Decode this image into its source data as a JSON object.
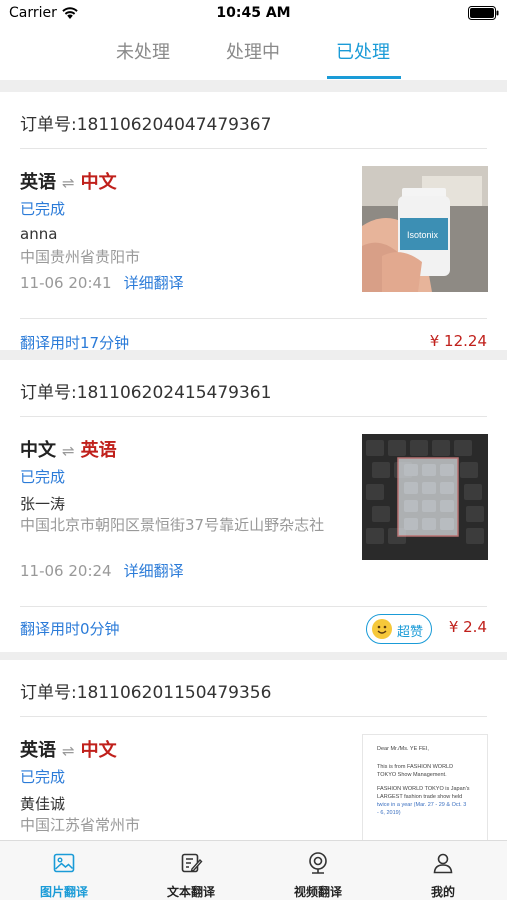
{
  "status_bar": {
    "carrier": "Carrier",
    "time": "10:45 AM"
  },
  "tabs": [
    {
      "label": "未处理",
      "active": false
    },
    {
      "label": "处理中",
      "active": false
    },
    {
      "label": "已处理",
      "active": true
    }
  ],
  "orders": [
    {
      "order_no": "订单号:181106204047479367",
      "source_lang": "英语",
      "target_lang": "中文",
      "status": "已完成",
      "customer": "anna",
      "address": "中国贵州省贵阳市",
      "time": "11-06 20:41",
      "detail_link": "详细翻译",
      "duration": "翻译用时17分钟",
      "price": "¥ 12.24",
      "image": "hand-holding-bottle-photo"
    },
    {
      "order_no": "订单号:181106202415479361",
      "source_lang": "中文",
      "target_lang": "英语",
      "status": "已完成",
      "customer": "张一涛",
      "address": "中国北京市朝阳区景恒街37号靠近山野杂志社",
      "time": "11-06 20:24",
      "detail_link": "详细翻译",
      "duration": "翻译用时0分钟",
      "praise": "超赞",
      "price": "¥ 2.4",
      "image": "keyboard-photo"
    },
    {
      "order_no": "订单号:181106201150479356",
      "source_lang": "英语",
      "target_lang": "中文",
      "status": "已完成",
      "customer": "黄佳诚",
      "address": "中国江苏省常州市",
      "image": "document-photo",
      "doc_lines": [
        "Dear Mr./Ms. YE FEI,",
        "This is from FASHION WORLD",
        "TOKYO Show Management.",
        "FASHION WORLD TOKYO is Japan's",
        "LARGEST fashion trade show held",
        "twice in a year (Mar. 27 - 29 & Oct. 3",
        "- 6, 2019)"
      ]
    }
  ],
  "bottom_nav": [
    {
      "label": "图片翻译",
      "icon": "image-icon",
      "active": true
    },
    {
      "label": "文本翻译",
      "icon": "edit-icon",
      "active": false
    },
    {
      "label": "视频翻译",
      "icon": "webcam-icon",
      "active": false
    },
    {
      "label": "我的",
      "icon": "user-icon",
      "active": false
    }
  ],
  "colors": {
    "accent": "#1a9bd7",
    "price": "#c0201b",
    "link": "#2b7bd8"
  }
}
